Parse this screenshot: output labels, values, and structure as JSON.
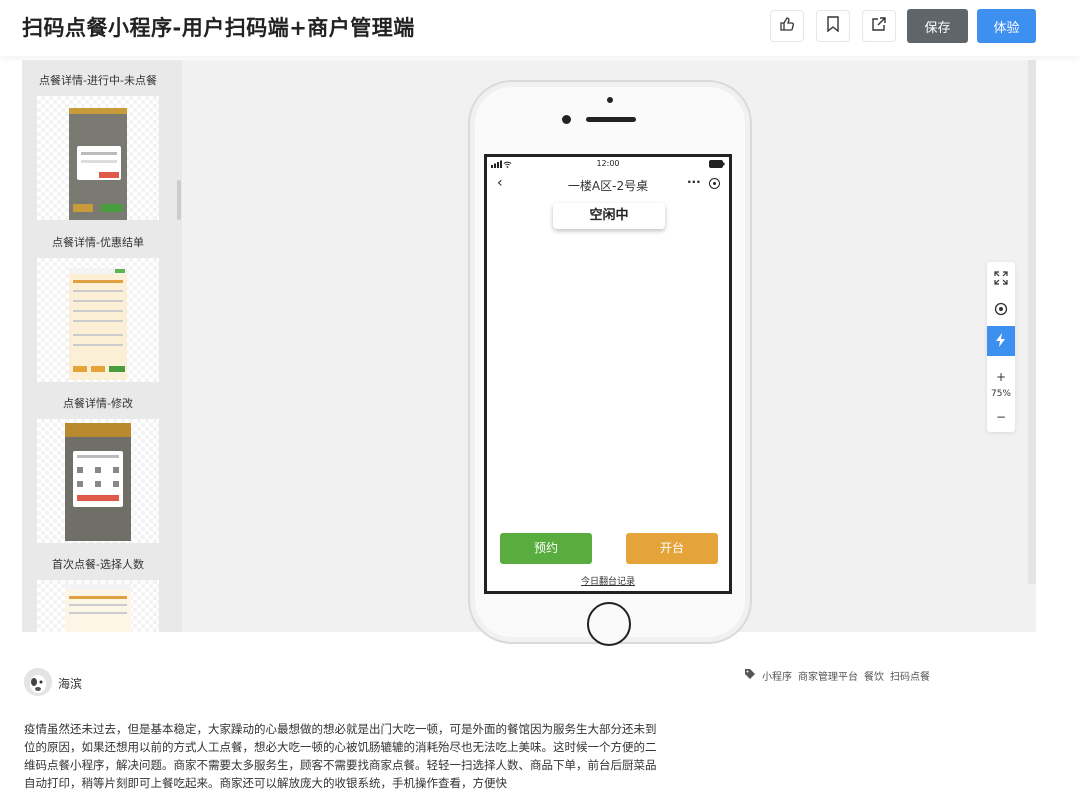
{
  "header": {
    "title": "扫码点餐小程序-用户扫码端+商户管理端",
    "save_label": "保存",
    "try_label": "体验"
  },
  "sidebar": {
    "items": [
      {
        "label": "点餐详情-进行中-未点餐"
      },
      {
        "label": "点餐详情-优惠结单"
      },
      {
        "label": "点餐详情-修改"
      },
      {
        "label": "首次点餐-选择人数"
      }
    ]
  },
  "phone": {
    "time": "12:00",
    "nav_title": "一楼A区-2号桌",
    "status": "空闲中",
    "reserve_label": "预约",
    "open_label": "开台",
    "record_link": "今日翻台记录"
  },
  "toolbar": {
    "zoom": "75%"
  },
  "post": {
    "author": "海滨",
    "tags": [
      "小程序",
      "商家管理平台",
      "餐饮",
      "扫码点餐"
    ],
    "description": "疫情虽然还未过去，但是基本稳定，大家躁动的心最想做的想必就是出门大吃一顿，可是外面的餐馆因为服务生大部分还未到位的原因，如果还想用以前的方式人工点餐，想必大吃一顿的心被饥肠辘辘的消耗殆尽也无法吃上美味。这时候一个方便的二维码点餐小程序，解决问题。商家不需要太多服务生，顾客不需要找商家点餐。轻轻一扫选择人数、商品下单，前台后厨菜品自动打印，稍等片刻即可上餐吃起来。商家还可以解放庞大的收银系统，手机操作查看，方便快"
  },
  "colors": {
    "primary_blue": "#3d8ff0",
    "save_gray": "#5f666b",
    "green": "#58ad3e",
    "orange": "#e5a43a"
  }
}
